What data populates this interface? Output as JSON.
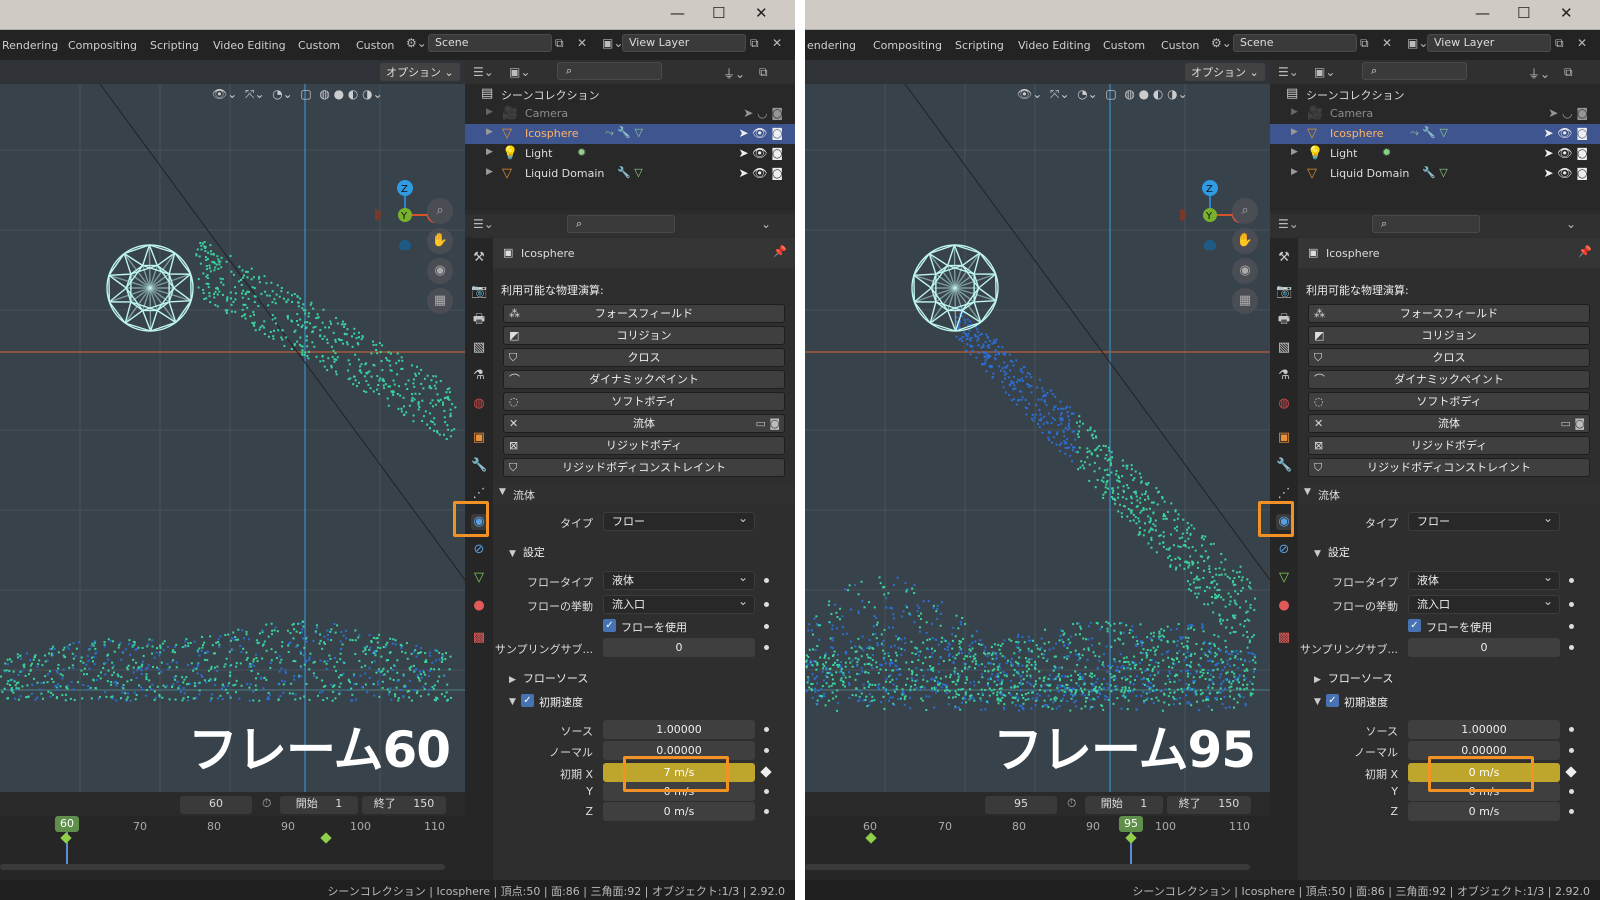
{
  "panes": [
    {
      "tabs": [
        "Rendering",
        "Compositing",
        "Scripting",
        "Video Editing",
        "Custom",
        "Custon"
      ],
      "scene": "Scene",
      "view_layer": "View Layer",
      "options": "オプション",
      "frame_label": "フレーム60",
      "outliner": {
        "root": "シーンコレクション",
        "items": [
          {
            "label": "Camera"
          },
          {
            "label": "Icosphere"
          },
          {
            "label": "Light"
          },
          {
            "label": "Liquid Domain"
          }
        ]
      },
      "props": {
        "object": "Icosphere",
        "physics_title": "利用可能な物理演算:",
        "buttons": [
          "フォースフィールド",
          "コリジョン",
          "クロス",
          "ダイナミックペイント",
          "ソフトボディ",
          "流体",
          "リジッドボディ",
          "リジッドボディコンストレイント"
        ],
        "fluid_section": "流体",
        "type_label": "タイプ",
        "type_value": "フロー",
        "settings": "設定",
        "flow_type_label": "フロータイプ",
        "flow_type_value": "液体",
        "flow_behavior_label": "フローの挙動",
        "flow_behavior_value": "流入口",
        "use_flow": "フローを使用",
        "sampling_label": "サンプリングサブ...",
        "sampling_value": "0",
        "flow_source": "フローソース",
        "initial_velocity": "初期速度",
        "source_label": "ソース",
        "source_value": "1.00000",
        "normal_label": "ノーマル",
        "normal_value": "0.00000",
        "init_x_label": "初期 X",
        "init_x_value": "7 m/s",
        "y_label": "Y",
        "y_value": "0 m/s",
        "z_label": "Z",
        "z_value": "0 m/s"
      },
      "timeline": {
        "current": "60",
        "start_label": "開始",
        "start": "1",
        "end_label": "終了",
        "end": "150",
        "ruler": [
          "60",
          "70",
          "80",
          "90",
          "100",
          "110"
        ],
        "marker": "60"
      },
      "status": "シーンコレクション | Icosphere | 頂点:50 | 面:86 | 三角面:92 | オブジェクト:1/3 | 2.92.0"
    },
    {
      "tabs": [
        "endering",
        "Compositing",
        "Scripting",
        "Video Editing",
        "Custom",
        "Custon"
      ],
      "scene": "Scene",
      "view_layer": "View Layer",
      "options": "オプション",
      "frame_label": "フレーム95",
      "outliner": {
        "root": "シーンコレクション",
        "items": [
          {
            "label": "Camera"
          },
          {
            "label": "Icosphere"
          },
          {
            "label": "Light"
          },
          {
            "label": "Liquid Domain"
          }
        ]
      },
      "props": {
        "object": "Icosphere",
        "physics_title": "利用可能な物理演算:",
        "buttons": [
          "フォースフィールド",
          "コリジョン",
          "クロス",
          "ダイナミックペイント",
          "ソフトボディ",
          "流体",
          "リジッドボディ",
          "リジッドボディコンストレイント"
        ],
        "fluid_section": "流体",
        "type_label": "タイプ",
        "type_value": "フロー",
        "settings": "設定",
        "flow_type_label": "フロータイプ",
        "flow_type_value": "液体",
        "flow_behavior_label": "フローの挙動",
        "flow_behavior_value": "流入口",
        "use_flow": "フローを使用",
        "sampling_label": "サンプリングサブ...",
        "sampling_value": "0",
        "flow_source": "フローソース",
        "initial_velocity": "初期速度",
        "source_label": "ソース",
        "source_value": "1.00000",
        "normal_label": "ノーマル",
        "normal_value": "0.00000",
        "init_x_label": "初期 X",
        "init_x_value": "0 m/s",
        "y_label": "Y",
        "y_value": "0 m/s",
        "z_label": "Z",
        "z_value": "0 m/s"
      },
      "timeline": {
        "current": "95",
        "start_label": "開始",
        "start": "1",
        "end_label": "終了",
        "end": "150",
        "ruler": [
          "60",
          "70",
          "80",
          "90",
          "100",
          "110"
        ],
        "marker": "95"
      },
      "status": "シーンコレクション | Icosphere | 頂点:50 | 面:86 | 三角面:92 | オブジェクト:1/3 | 2.92.0"
    }
  ],
  "colors": {
    "highlight": "#f39224",
    "keyframe": "#bea52b",
    "selection": "#3f5590",
    "particle_green": "#3ad4a0",
    "particle_blue": "#2b6fd6"
  }
}
